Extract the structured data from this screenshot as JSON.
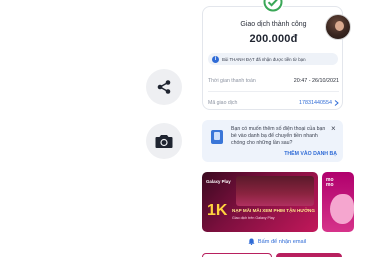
{
  "receipt": {
    "title": "Giao dịch thành công",
    "amount": "200.000đ",
    "note": "Bùi THANH ĐẠT đã nhận được tiền từ bạn",
    "time_label": "Thời gian thanh toán",
    "time_value": "20:47 - 26/10/2021",
    "code_label": "Mã giao dịch",
    "code_value": "17831440554"
  },
  "contact_card": {
    "message": "Bạn có muốn thêm số điện thoại của bạn bè vào danh bạ để chuyển tiền nhanh chóng cho những lần sau?",
    "action_label": "THÊM VÀO DANH BẠ",
    "close_glyph": "×"
  },
  "promo_banner": {
    "brand": "Galaxy Play",
    "percent": "1K",
    "headline": "NẠP MÃI MÃI XEM PHIM TẬN HƯỞNG",
    "subline": "Giao dịch trên Galaxy Play"
  },
  "side_banner": {
    "brand": "mo\nmo"
  },
  "notify": {
    "label": "Bấm để nhận email"
  },
  "icons": {
    "success": "check-circle-icon",
    "share": "share-icon",
    "camera": "camera-icon",
    "info": "info-icon",
    "phone": "contacts-icon",
    "bell": "bell-icon"
  },
  "colors": {
    "success": "#3aa757",
    "link": "#2f6bd6",
    "momo": "#b8205f"
  }
}
